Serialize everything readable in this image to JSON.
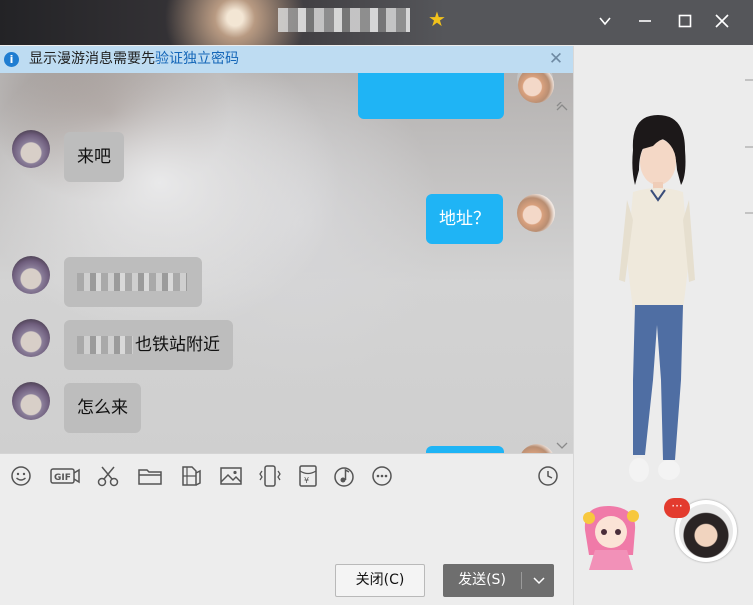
{
  "window": {
    "title_obscured": true,
    "controls": [
      "chevron-down-icon",
      "minimize-icon",
      "maximize-icon",
      "close-icon"
    ]
  },
  "notice": {
    "text": "显示漫游消息需要先",
    "link": "验证独立密码"
  },
  "messages": [
    {
      "side": "in",
      "text": "来吧"
    },
    {
      "side": "out",
      "text": "地址？"
    },
    {
      "side": "in",
      "text": "",
      "obscured": true
    },
    {
      "side": "in",
      "text": "地铁站附近",
      "obscured_prefix": true
    },
    {
      "side": "in",
      "text": "怎么来"
    }
  ],
  "message_partial_suffix": "也铁站附近",
  "toolbar": {
    "icons": [
      "emoji-icon",
      "gif-icon",
      "scissors-icon",
      "folder-icon",
      "file-share-icon",
      "image-icon",
      "shake-icon",
      "red-envelope-icon",
      "music-icon",
      "more-icon",
      "history-clock-icon"
    ]
  },
  "buttons": {
    "close_label": "关闭(C)",
    "send_label": "发送(S)"
  },
  "colors": {
    "accent_blue": "#1fb4f5",
    "titlebar": "#55565a",
    "notice_bg": "#bedcf2",
    "send_button": "#6e6e6e"
  },
  "badge": {
    "text": "···"
  }
}
